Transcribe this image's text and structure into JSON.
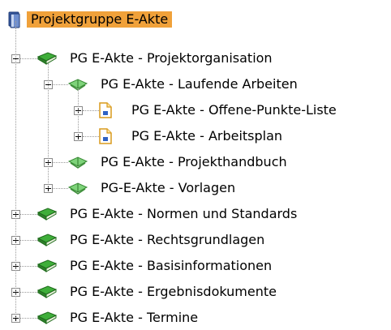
{
  "tree": {
    "root": {
      "label": "Projektgruppe E-Akte",
      "icon": "book-stack-icon",
      "highlight": "#f0a13a"
    },
    "items": [
      {
        "id": "projektorganisation",
        "label": "PG E-Akte - Projektorganisation",
        "level": 1,
        "expanded": true,
        "icon": "book-closed-icon"
      },
      {
        "id": "laufende-arbeiten",
        "label": "PG E-Akte - Laufende Arbeiten",
        "level": 2,
        "expanded": true,
        "icon": "book-open-icon"
      },
      {
        "id": "offene-punkte-liste",
        "label": "PG E-Akte - Offene-Punkte-Liste",
        "level": 3,
        "expanded": false,
        "icon": "document-icon"
      },
      {
        "id": "arbeitsplan",
        "label": "PG E-Akte - Arbeitsplan",
        "level": 3,
        "expanded": false,
        "icon": "document-icon"
      },
      {
        "id": "projekthandbuch",
        "label": "PG E-Akte - Projekthandbuch",
        "level": 2,
        "expanded": false,
        "icon": "book-open-icon"
      },
      {
        "id": "vorlagen",
        "label": "PG-E-Akte - Vorlagen",
        "level": 2,
        "expanded": false,
        "icon": "book-open-icon"
      },
      {
        "id": "normen-und-standards",
        "label": "PG E-Akte - Normen und Standards",
        "level": 1,
        "expanded": false,
        "icon": "book-closed-icon"
      },
      {
        "id": "rechtsgrundlagen",
        "label": "PG E-Akte - Rechtsgrundlagen",
        "level": 1,
        "expanded": false,
        "icon": "book-closed-icon"
      },
      {
        "id": "basisinformationen",
        "label": "PG E-Akte - Basisinformationen",
        "level": 1,
        "expanded": false,
        "icon": "book-closed-icon"
      },
      {
        "id": "ergebnisdokumente",
        "label": "PG E-Akte - Ergebnisdokumente",
        "level": 1,
        "expanded": false,
        "icon": "book-closed-icon"
      },
      {
        "id": "termine",
        "label": "PG E-Akte - Termine",
        "level": 1,
        "expanded": false,
        "icon": "book-closed-icon"
      }
    ]
  }
}
